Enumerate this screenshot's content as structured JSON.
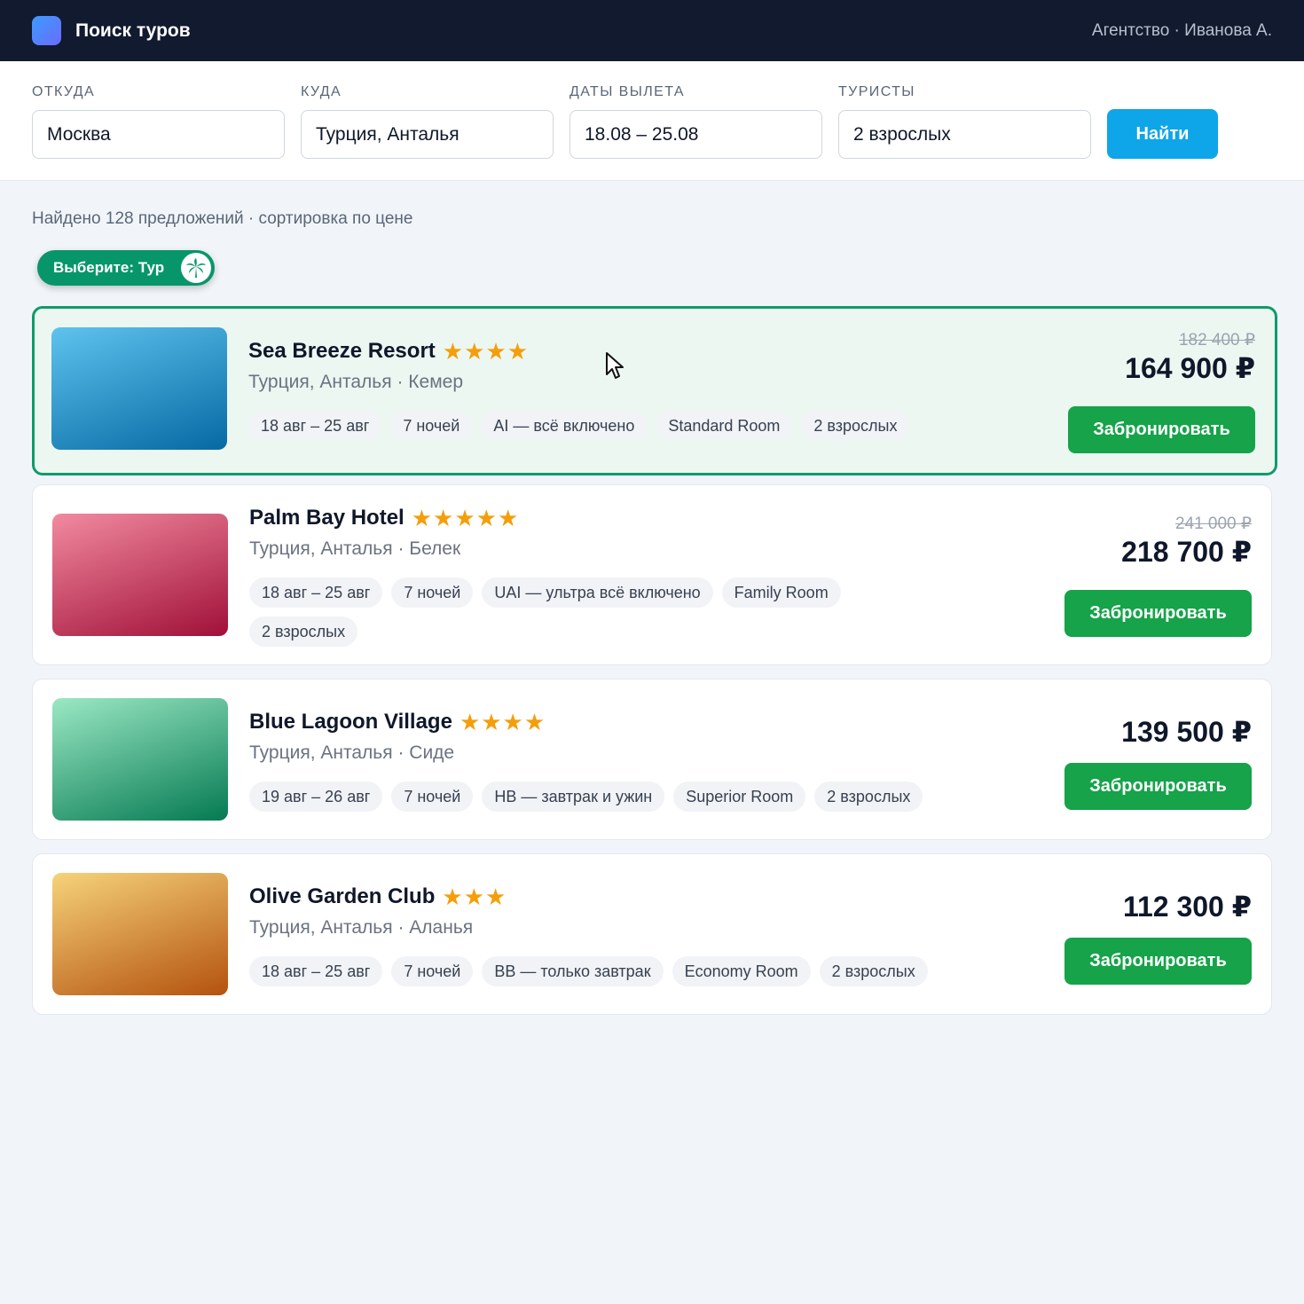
{
  "header": {
    "title": "Поиск туров",
    "agency": "Агентство · Иванова А."
  },
  "search": {
    "from_label": "ОТКУДА",
    "from_value": "Москва",
    "to_label": "КУДА",
    "to_value": "Турция, Анталья",
    "dates_label": "ДАТЫ ВЫЛЕТА",
    "dates_value": "18.08 – 25.08",
    "tourists_label": "ТУРИСТЫ",
    "tourists_value": "2 взрослых",
    "find_label": "Найти"
  },
  "results": {
    "summary": "Найдено 128 предложений · сортировка по цене"
  },
  "hint": {
    "label": "Выберите: Тур",
    "icon": "palm-tree-icon"
  },
  "tours": [
    {
      "name": "Sea Breeze Resort",
      "stars": "★★★★",
      "location": "Турция, Анталья · Кемер",
      "chips": [
        "18 авг – 25 авг",
        "7 ночей",
        "AI — всё включено",
        "Standard Room",
        "2 взрослых"
      ],
      "old_price": "182 400 ₽",
      "price": "164 900 ₽",
      "book_label": "Забронировать",
      "thumb_from": "#5ec3ee",
      "thumb_to": "#0669a3"
    },
    {
      "name": "Palm Bay Hotel",
      "stars": "★★★★★",
      "location": "Турция, Анталья · Белек",
      "chips": [
        "18 авг – 25 авг",
        "7 ночей",
        "UAI — ультра всё включено",
        "Family Room",
        "2 взрослых"
      ],
      "old_price": "241 000 ₽",
      "price": "218 700 ₽",
      "book_label": "Забронировать",
      "thumb_from": "#f28aa0",
      "thumb_to": "#a01038"
    },
    {
      "name": "Blue Lagoon Village",
      "stars": "★★★★",
      "location": "Турция, Анталья · Сиде",
      "chips": [
        "19 авг – 26 авг",
        "7 ночей",
        "HB — завтрак и ужин",
        "Superior Room",
        "2 взрослых"
      ],
      "old_price": "",
      "price": "139 500 ₽",
      "book_label": "Забронировать",
      "thumb_from": "#9be8c4",
      "thumb_to": "#057a52"
    },
    {
      "name": "Olive Garden Club",
      "stars": "★★★",
      "location": "Турция, Анталья · Аланья",
      "chips": [
        "18 авг – 25 авг",
        "7 ночей",
        "BB — только завтрак",
        "Economy Room",
        "2 взрослых"
      ],
      "old_price": "",
      "price": "112 300 ₽",
      "book_label": "Забронировать",
      "thumb_from": "#f6d37a",
      "thumb_to": "#b4520e"
    }
  ],
  "colors": {
    "header_bg": "#111a2e",
    "accent": "#0ea5e9",
    "book": "#16a34a",
    "selected_border": "#0f9b6a",
    "stars": "#f59e0b"
  }
}
